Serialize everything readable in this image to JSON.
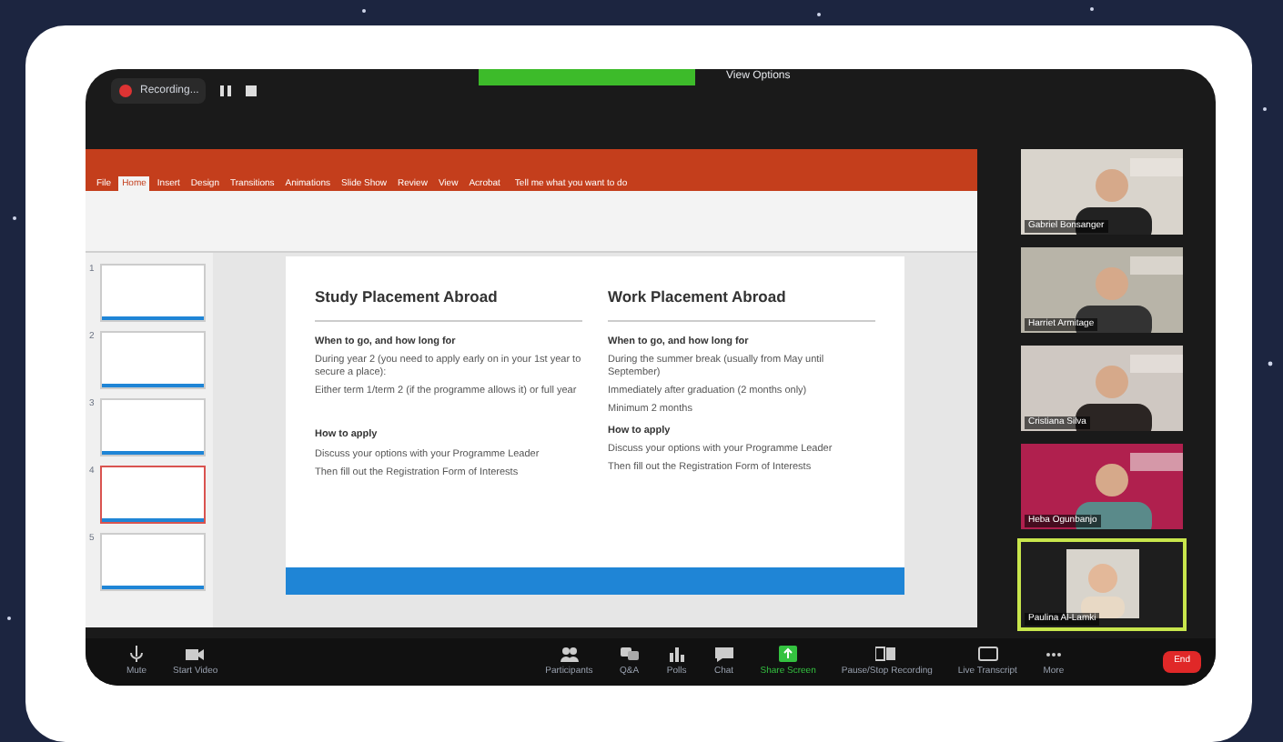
{
  "top_bar": {
    "recording": "Recording...",
    "view_options": "View Options"
  },
  "ppt": {
    "tabs": [
      {
        "label": "File",
        "selected": false
      },
      {
        "label": "Home",
        "selected": true
      },
      {
        "label": "Insert",
        "selected": false
      },
      {
        "label": "Design",
        "selected": false
      },
      {
        "label": "Transitions",
        "selected": false
      },
      {
        "label": "Animations",
        "selected": false
      },
      {
        "label": "Slide Show",
        "selected": false
      },
      {
        "label": "Review",
        "selected": false
      },
      {
        "label": "View",
        "selected": false
      },
      {
        "label": "Acrobat",
        "selected": false
      }
    ],
    "tell_me": "Tell me what you want to do",
    "thumbnails": [
      {
        "number": "1",
        "selected": false
      },
      {
        "number": "2",
        "selected": false
      },
      {
        "number": "3",
        "selected": false
      },
      {
        "number": "4",
        "selected": true
      },
      {
        "number": "5",
        "selected": false
      }
    ],
    "slide": {
      "columns": [
        {
          "title": "Study Placement Abroad",
          "blocks": [
            {
              "kind": "heading",
              "text": "When to go, and how long for"
            },
            {
              "kind": "para",
              "text": "During year 2 (you need to apply early on in your 1st year to secure a place):"
            },
            {
              "kind": "para",
              "text": "Either term 1/term 2 (if the programme allows it) or full year"
            },
            {
              "kind": "gap"
            },
            {
              "kind": "heading",
              "text": "How to apply"
            },
            {
              "kind": "para",
              "text": "Discuss your options with your Programme Leader"
            },
            {
              "kind": "para",
              "text": "Then fill out the Registration Form of Interests"
            }
          ]
        },
        {
          "title": "Work Placement Abroad",
          "blocks": [
            {
              "kind": "heading",
              "text": "When to go, and how long for"
            },
            {
              "kind": "para",
              "text": "During the summer break (usually from May until September)"
            },
            {
              "kind": "para",
              "text": "Immediately after graduation (2 months only)"
            },
            {
              "kind": "para",
              "text": "Minimum 2 months"
            },
            {
              "kind": "heading",
              "text": "How to apply"
            },
            {
              "kind": "para",
              "text": "Discuss your options with your Programme Leader"
            },
            {
              "kind": "para",
              "text": "Then fill out the Registration Form of Interests"
            }
          ]
        }
      ]
    }
  },
  "participants": [
    {
      "name": "Gabriel Bonsanger",
      "selected": false
    },
    {
      "name": "Harriet Armitage",
      "selected": false
    },
    {
      "name": "Cristiana Silva",
      "selected": false
    },
    {
      "name": "Heba Ogunbanjo",
      "selected": false
    },
    {
      "name": "Paulina Al-Lamki",
      "selected": true
    }
  ],
  "toolbar": [
    {
      "kind": "mic",
      "label": "Mute"
    },
    {
      "kind": "video",
      "label": "Start Video"
    },
    {
      "kind": "people",
      "label": "Participants"
    },
    {
      "kind": "qa",
      "label": "Q&A"
    },
    {
      "kind": "polls",
      "label": "Polls"
    },
    {
      "kind": "chat",
      "label": "Chat"
    },
    {
      "kind": "share",
      "label": "Share Screen"
    },
    {
      "kind": "record",
      "label": "Pause/Stop Recording"
    },
    {
      "kind": "cc",
      "label": "Live Transcript"
    },
    {
      "kind": "more",
      "label": "More"
    }
  ],
  "end_button": "End"
}
